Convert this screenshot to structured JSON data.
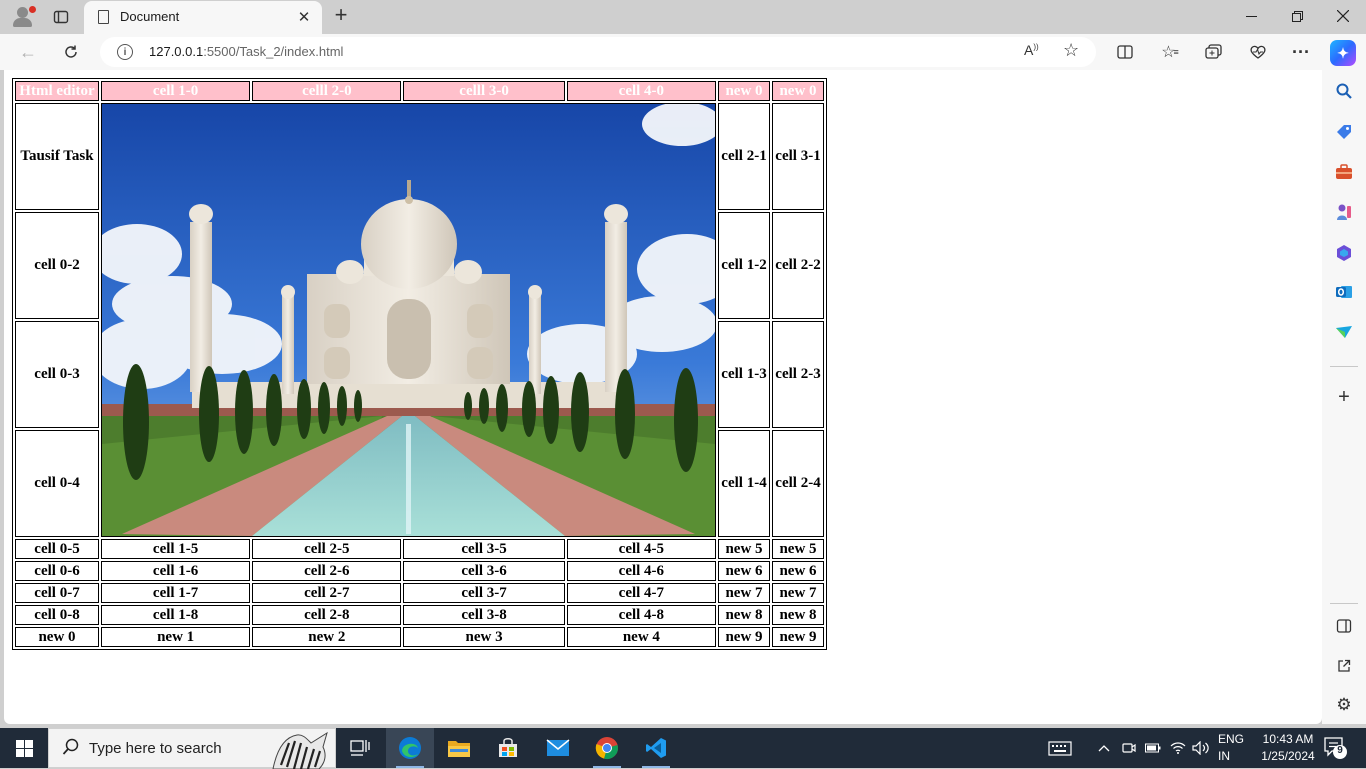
{
  "browser": {
    "tab_title": "Document",
    "url_host": "127.0.0.1",
    "url_rest": ":5500/Task_2/index.html"
  },
  "table": {
    "header": [
      "Html editor",
      "cell 1-0",
      "celll 2-0",
      "celll 3-0",
      "cell 4-0",
      "new 0",
      "new 0"
    ],
    "tall_rows": [
      {
        "left": "Tausif Task",
        "right1": "cell 2-1",
        "right2": "cell 3-1"
      },
      {
        "left": "cell 0-2",
        "right1": "cell 1-2",
        "right2": "cell 2-2"
      },
      {
        "left": "cell 0-3",
        "right1": "cell 1-3",
        "right2": "cell 2-3"
      },
      {
        "left": "cell 0-4",
        "right1": "cell 1-4",
        "right2": "cell 2-4"
      }
    ],
    "rows": [
      [
        "cell 0-5",
        "cell 1-5",
        "cell 2-5",
        "cell 3-5",
        "cell 4-5",
        "new 5",
        "new 5"
      ],
      [
        "cell 0-6",
        "cell 1-6",
        "cell 2-6",
        "cell 3-6",
        "cell 4-6",
        "new 6",
        "new 6"
      ],
      [
        "cell 0-7",
        "cell 1-7",
        "cell 2-7",
        "cell 3-7",
        "cell 4-7",
        "new 7",
        "new 7"
      ],
      [
        "cell 0-8",
        "cell 1-8",
        "cell 2-8",
        "cell 3-8",
        "cell 4-8",
        "new 8",
        "new 8"
      ],
      [
        "new 0",
        "new 1",
        "new 2",
        "new 3",
        "new 4",
        "new 9",
        "new 9"
      ]
    ],
    "header_bg": "#ffc0cb"
  },
  "taskbar": {
    "search_placeholder": "Type here to search",
    "lang_line1": "ENG",
    "lang_line2": "IN",
    "time": "10:43 AM",
    "date": "1/25/2024",
    "notification_count": "9"
  },
  "icons": {
    "toolbar": [
      "back-icon",
      "refresh-icon",
      "info-icon",
      "read-aloud-icon",
      "favorite-star-icon",
      "split-screen-icon",
      "favorites-icon",
      "collections-icon",
      "performance-icon",
      "more-icon",
      "copilot-icon"
    ],
    "sidebar": [
      "search-icon",
      "shopping-tag-icon",
      "tools-icon",
      "games-icon",
      "microsoft-365-icon",
      "outlook-icon",
      "drop-icon",
      "add-icon",
      "sidebar-toggle-icon",
      "open-external-icon",
      "settings-icon"
    ],
    "taskbar": [
      "windows-start-icon",
      "search-icon",
      "task-view-icon",
      "edge-icon",
      "file-explorer-icon",
      "microsoft-store-icon",
      "mail-icon",
      "chrome-icon",
      "vscode-icon"
    ]
  }
}
